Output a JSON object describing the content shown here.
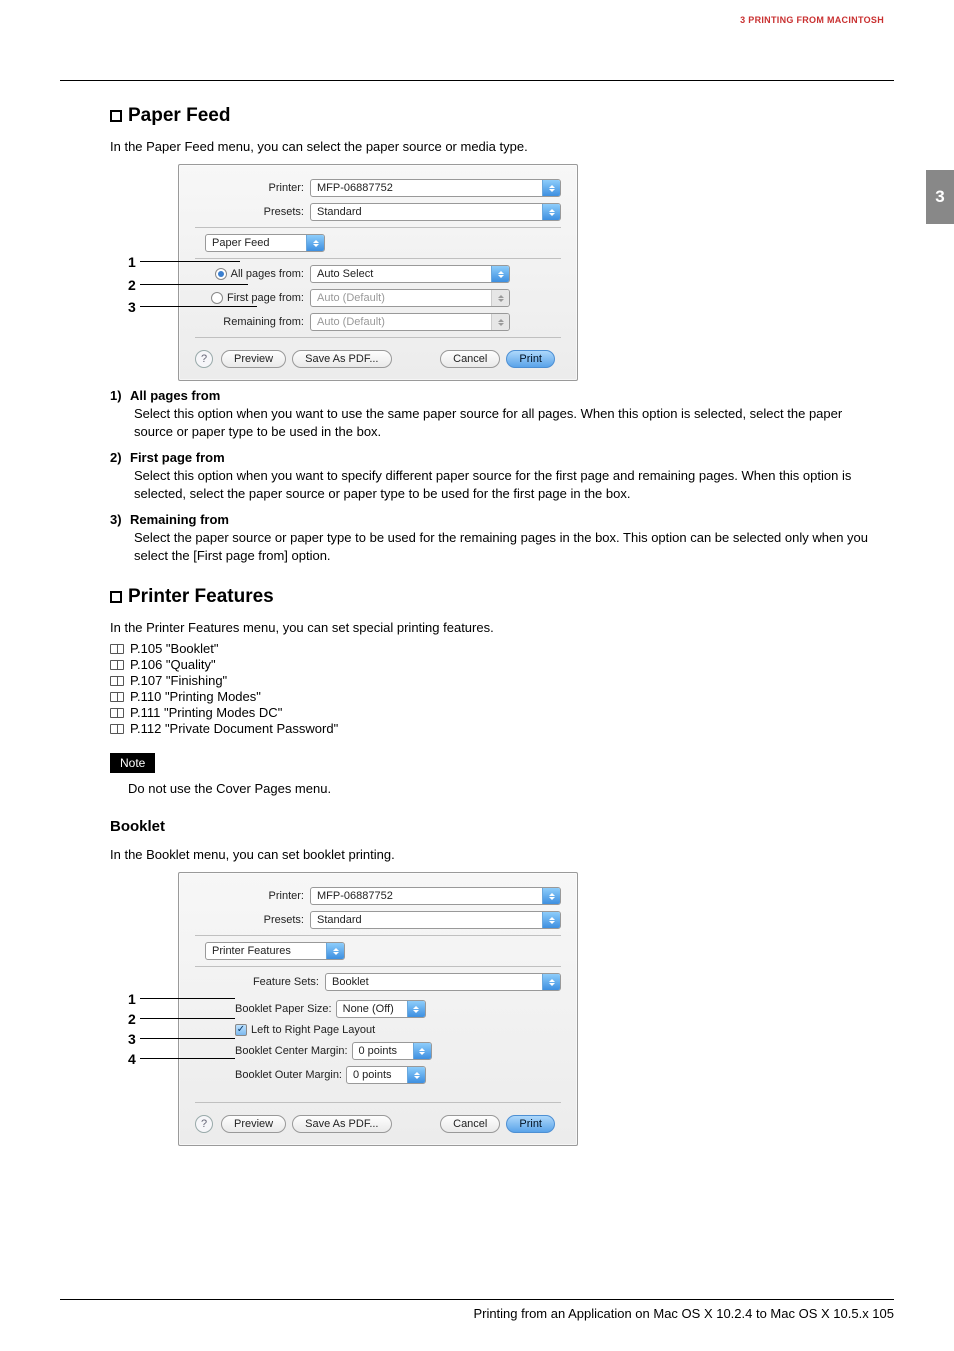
{
  "header": {
    "chapter_label": "3 PRINTING FROM MACINTOSH",
    "chapter_num": "3"
  },
  "section1": {
    "title": "Paper Feed",
    "intro": "In the Paper Feed menu, you can select the paper source or media type."
  },
  "dialog1": {
    "printer_label": "Printer:",
    "printer_value": "MFP-06887752",
    "presets_label": "Presets:",
    "presets_value": "Standard",
    "menu_value": "Paper Feed",
    "opt1_label": "All pages from:",
    "opt1_value": "Auto Select",
    "opt2_label": "First page from:",
    "opt2_value": "Auto (Default)",
    "opt3_label": "Remaining from:",
    "opt3_value": "Auto (Default)",
    "callouts": {
      "c1": "1",
      "c2": "2",
      "c3": "3"
    },
    "buttons": {
      "help": "?",
      "preview": "Preview",
      "save_pdf": "Save As PDF...",
      "cancel": "Cancel",
      "print": "Print"
    }
  },
  "desc1": {
    "items": [
      {
        "n": "1)",
        "t": "All pages from",
        "b": "Select this option when you want to use the same paper source for all pages. When this option is selected, select the paper source or paper type to be used in the box."
      },
      {
        "n": "2)",
        "t": "First page from",
        "b": "Select this option when you want to specify different paper source for the first page and remaining pages. When this option is selected, select the paper source or paper type to be used for the first page in the box."
      },
      {
        "n": "3)",
        "t": "Remaining from",
        "b": "Select the paper source or paper type to be used for the remaining pages in the box. This option can be selected only when you select the [First page from] option."
      }
    ]
  },
  "section2": {
    "title": "Printer Features",
    "intro": "In the Printer Features menu, you can set special printing features.",
    "refs": [
      "P.105 \"Booklet\"",
      "P.106 \"Quality\"",
      "P.107 \"Finishing\"",
      "P.110 \"Printing Modes\"",
      "P.111 \"Printing Modes DC\"",
      "P.112 \"Private Document Password\""
    ],
    "note_label": "Note",
    "note_text": "Do not use the Cover Pages menu."
  },
  "section3": {
    "title": "Booklet",
    "intro": "In the Booklet menu, you can set booklet printing."
  },
  "dialog2": {
    "printer_label": "Printer:",
    "printer_value": "MFP-06887752",
    "presets_label": "Presets:",
    "presets_value": "Standard",
    "menu_value": "Printer Features",
    "feature_sets_label": "Feature Sets:",
    "feature_sets_value": "Booklet",
    "r1_label": "Booklet Paper Size:",
    "r1_value": "None (Off)",
    "r2_label": "Left to Right Page Layout",
    "r3_label": "Booklet Center Margin:",
    "r3_value": "0 points",
    "r4_label": "Booklet Outer Margin:",
    "r4_value": "0 points",
    "callouts": {
      "c1": "1",
      "c2": "2",
      "c3": "3",
      "c4": "4"
    },
    "buttons": {
      "help": "?",
      "preview": "Preview",
      "save_pdf": "Save As PDF...",
      "cancel": "Cancel",
      "print": "Print"
    }
  },
  "footer": {
    "text": "Printing from an Application on Mac OS X 10.2.4 to Mac OS X 10.5.x    105"
  }
}
